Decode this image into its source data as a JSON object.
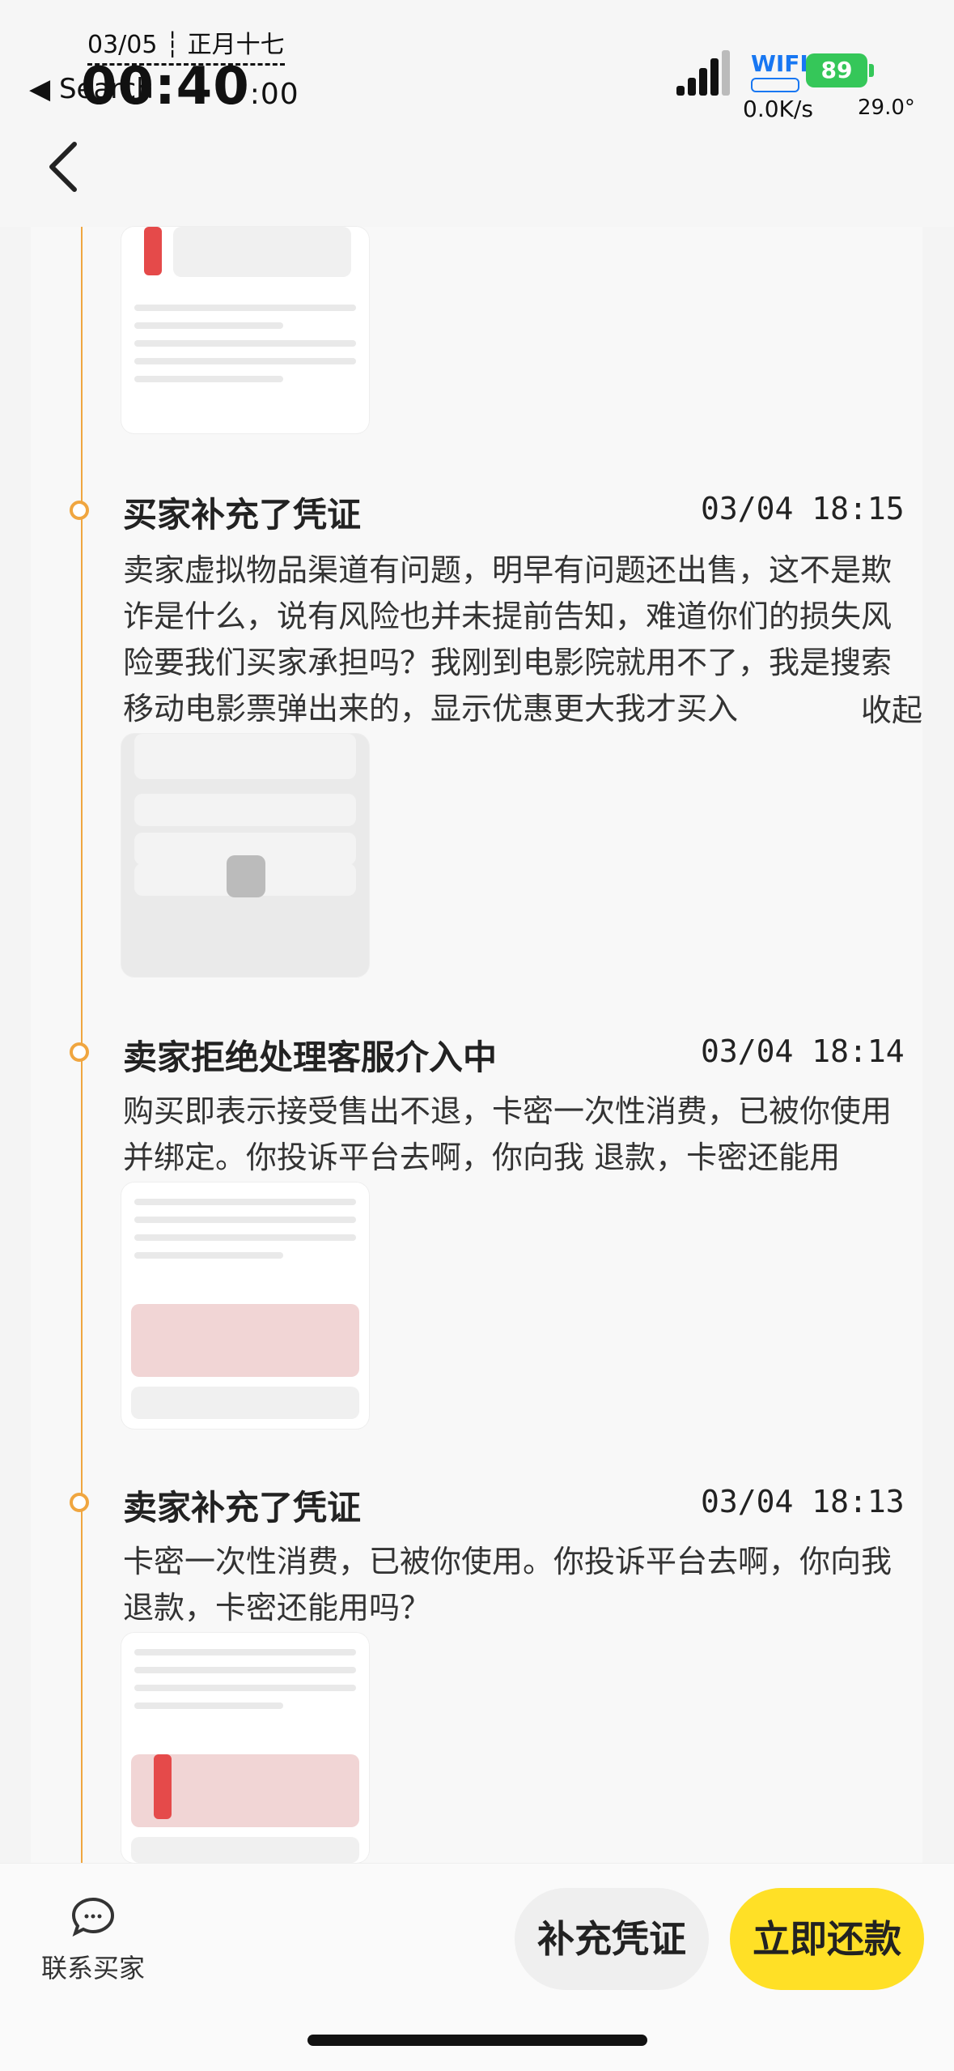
{
  "status_bar": {
    "date": "03/05 ┆ 正月十七",
    "back_label": "◀ Search",
    "time_main": "00:40",
    "time_seconds": ":00",
    "wifi_label": "WIFI",
    "battery": "89",
    "net_speed": "0.0K/s",
    "temperature": "29.0°"
  },
  "entries": [
    {
      "title": "买家补充了凭证",
      "time": "03/04 18:15",
      "body": "卖家虚拟物品渠道有问题，明早有问题还出售，这不是欺诈是什么，说有风险也并未提前告知，难道你们的损失风险要我们买家承担吗？我刚到电影院就用不了，我是搜索移动电影票弹出来的，显示优惠更大我才买入",
      "collapse": "收起"
    },
    {
      "title": "卖家拒绝处理客服介入中",
      "time": "03/04 18:14",
      "body": "购买即表示接受售出不退，卡密一次性消费，已被你使用并绑定。你投诉平台去啊，你向我 退款，卡密还能用吗？"
    },
    {
      "title": "卖家补充了凭证",
      "time": "03/04 18:13",
      "body": "卡密一次性消费，已被你使用。你投诉平台去啊，你向我退款，卡密还能用吗？"
    }
  ],
  "bottom_bar": {
    "contact_label": "联系买家",
    "secondary_button": "补充凭证",
    "primary_button": "立即还款"
  },
  "colors": {
    "timeline": "#f0a640",
    "primary_button": "#ffe026",
    "battery": "#35c759",
    "wifi": "#1877f2"
  }
}
